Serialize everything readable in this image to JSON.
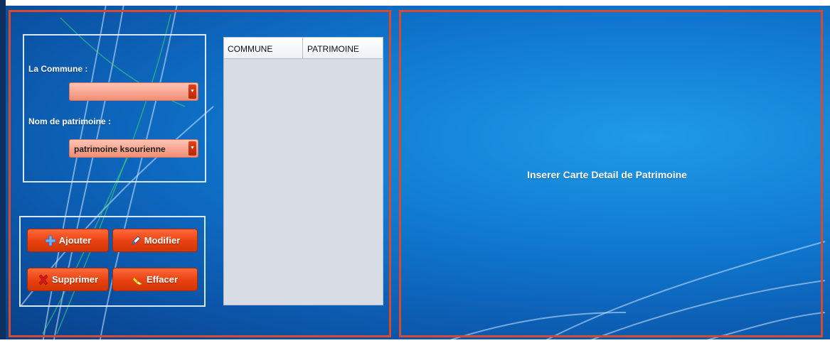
{
  "form": {
    "commune_label": "La Commune  :",
    "commune_value": "",
    "patrimoine_label": "Nom de patrimoine :",
    "patrimoine_value": "patrimoine ksourienne"
  },
  "buttons": {
    "add": "Ajouter",
    "edit": "Modifier",
    "delete": "Supprimer",
    "clear": "Effacer"
  },
  "table": {
    "columns": [
      "COMMUNE",
      "PATRIMOINE"
    ],
    "rows": []
  },
  "map": {
    "placeholder": "Inserer  Carte Detail de Patrimoine"
  },
  "icons": {
    "add": "plus-icon",
    "edit": "pen-icon",
    "delete": "cross-icon",
    "clear": "eraser-icon",
    "dropdown": "chevron-down-icon"
  },
  "colors": {
    "accent": "#e8410f",
    "panel_border": "#d94a2c",
    "combo_fill": "#f4a68f",
    "background": "#0f77cf"
  }
}
